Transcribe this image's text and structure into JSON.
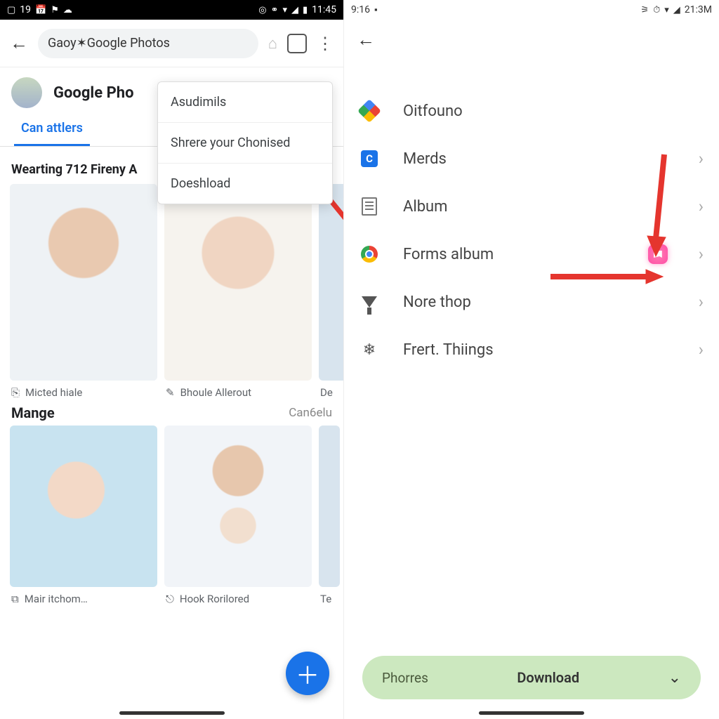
{
  "left": {
    "statusbar": {
      "left_text": "19",
      "right_text": "11:45"
    },
    "browser": {
      "url_text": "Gaoy✶Google Photos"
    },
    "app": {
      "title": "Google Pho",
      "tab_active": "Can attlers"
    },
    "dropdown": {
      "item1": "Asudimils",
      "item2": "Shrere your Chonised",
      "item3": "Doeshload"
    },
    "section1": {
      "heading": "Wearting 712 Fireny A"
    },
    "thumbs1": {
      "a_label": "Micted hiale",
      "b_label": "Bhoule Allerout",
      "c_label": "De"
    },
    "section2": {
      "heading": "Mange",
      "link": "Can6elu"
    },
    "thumbs2": {
      "a_label": "Mair itchom…",
      "b_label": "Hook Rorilored",
      "c_label": "Te"
    }
  },
  "right": {
    "statusbar": {
      "left_text": "9:16",
      "right_text": "21:3M"
    },
    "menu": {
      "item1": "Oitfouno",
      "item2": "Merds",
      "item3": "Album",
      "item4": "Forms album",
      "item5": "Nore thop",
      "item6": "Frert. Thiings"
    },
    "pill": {
      "left": "Phorres",
      "main": "Download"
    }
  }
}
